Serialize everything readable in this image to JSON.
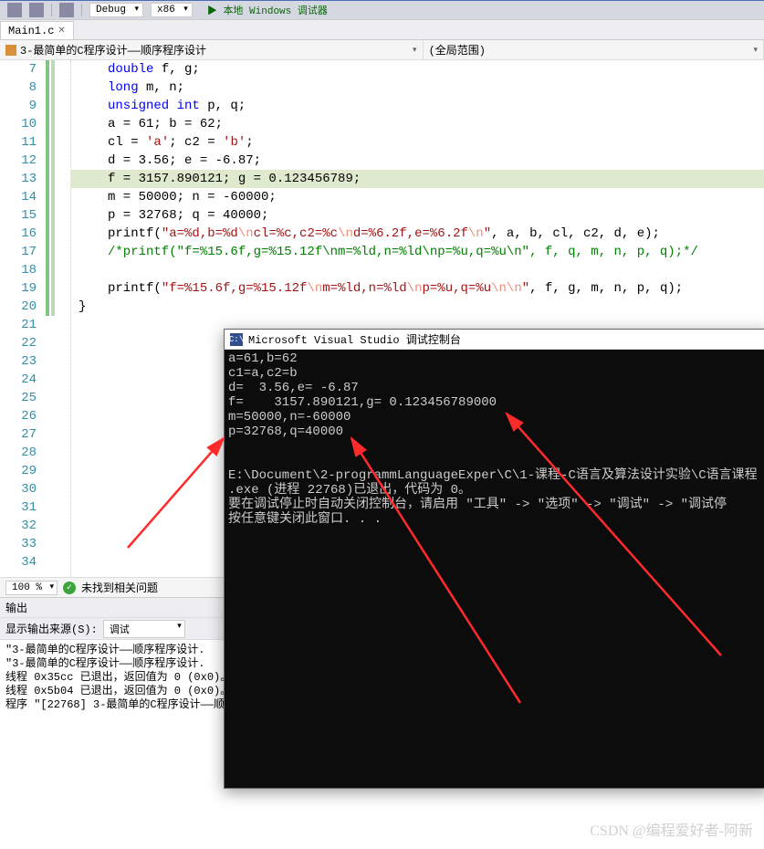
{
  "toolbar": {
    "config": "Debug",
    "platform": "x86",
    "run_label": "本地 Windows 调试器"
  },
  "tab": {
    "name": "Main1.c"
  },
  "nav": {
    "left": "3-最简单的C程序设计——顺序程序设计",
    "right": "(全局范围)"
  },
  "lines": {
    "start": 7,
    "count": 28
  },
  "code": {
    "l7": "        double f, g;",
    "l8": "        long m, n;",
    "l9": "        unsigned int p, q;",
    "l10": "        a = 61; b = 62;",
    "l11": "        cl = 'a'; c2 = 'b';",
    "l12": "        d = 3.56; e = -6.87;",
    "l13": "        f = 3157.890121; g = 0.123456789;",
    "l14": "        m = 50000; n = -60000;",
    "l15": "        p = 32768; q = 40000;",
    "l16a": "        printf(",
    "l16b": "\"a=%d,b=%d",
    "l16c": "\\n",
    "l16d": "cl=%c,c2=%c",
    "l16e": "\\n",
    "l16f": "d=%6.2f,e=%6.2f",
    "l16g": "\\n",
    "l16h": "\"",
    "l16i": ", a, b, cl, c2, d, e);",
    "l17": "        /*printf(\"f=%15.6f,g=%15.12f\\nm=%ld,n=%ld\\np=%u,q=%u\\n\", f, q, m, n, p, q);*/",
    "l18": "",
    "l19a": "        printf(",
    "l19b": "\"f=%15.6f,g=%15.12f",
    "l19c": "\\n",
    "l19d": "m=%ld,n=%ld",
    "l19e": "\\n",
    "l19f": "p=%u,q=%u",
    "l19g": "\\n\\n",
    "l19h": "\"",
    "l19i": ", f, g, m, n, p, q);",
    "l20": "    }"
  },
  "status": {
    "zoom": "100 %",
    "issues": "未找到相关问题"
  },
  "output": {
    "title": "输出",
    "src_label": "显示输出来源(S):",
    "src_value": "调试",
    "lines": [
      "\"3-最简单的C程序设计——顺序程序设计.",
      "\"3-最简单的C程序设计——顺序程序设计.",
      "线程 0x35cc 已退出，返回值为 0 (0x0)。",
      "线程 0x5b04 已退出，返回值为 0 (0x0)。",
      "程序 \"[22768] 3-最简单的C程序设计——顺"
    ]
  },
  "console": {
    "title": "Microsoft Visual Studio 调试控制台",
    "lines": [
      "a=61,b=62",
      "c1=a,c2=b",
      "d=  3.56,e= -6.87",
      "f=    3157.890121,g= 0.123456789000",
      "m=50000,n=-60000",
      "p=32768,q=40000",
      "",
      "",
      "E:\\Document\\2-programmLanguageExper\\C\\1-课程-C语言及算法设计实验\\C语言课程",
      ".exe (进程 22768)已退出，代码为 0。",
      "要在调试停止时自动关闭控制台，请启用 \"工具\" -> \"选项\" -> \"调试\" -> \"调试停",
      "按任意键关闭此窗口. . ."
    ]
  },
  "watermark": "CSDN @编程爱好者-阿新"
}
